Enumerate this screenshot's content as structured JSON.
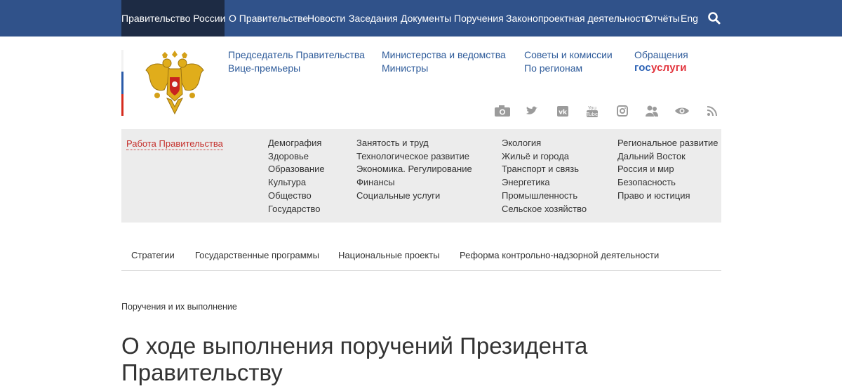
{
  "topbar": {
    "brand": "Правительство России",
    "nav": [
      "О Правительстве",
      "Новости",
      "Заседания",
      "Документы",
      "Поручения",
      "Законопроектная деятельность",
      "Отчёты",
      "Eng"
    ]
  },
  "header": {
    "col1": [
      "Председатель Правительства",
      "Вице-премьеры"
    ],
    "col2": [
      "Министерства и ведомства",
      "Министры"
    ],
    "col3": [
      "Советы и комиссии",
      "По регионам"
    ],
    "appeals": "Обращения",
    "gosuslugi_a": "гос",
    "gosuslugi_b": "услуги"
  },
  "social_icons": [
    "camera-icon",
    "twitter-icon",
    "vk-icon",
    "youtube-icon",
    "instagram-icon",
    "people-icon",
    "eye-icon",
    "rss-icon"
  ],
  "topics": {
    "heading": "Работа Правительства",
    "col1": [
      "Демография",
      "Здоровье",
      "Образование",
      "Культура",
      "Общество",
      "Государство"
    ],
    "col2": [
      "Занятость и труд",
      "Технологическое развитие",
      "Экономика. Регулирование",
      "Финансы",
      "Социальные услуги"
    ],
    "col3": [
      "Экология",
      "Жильё и города",
      "Транспорт и связь",
      "Энергетика",
      "Промышленность",
      "Сельское хозяйство"
    ],
    "col4": [
      "Региональное развитие",
      "Дальний Восток",
      "Россия и мир",
      "Безопасность",
      "Право и юстиция"
    ]
  },
  "subnav": [
    "Стратегии",
    "Государственные программы",
    "Национальные проекты",
    "Реформа контрольно-надзорной деятельности"
  ],
  "breadcrumb": "Поручения и их выполнение",
  "title_line1": "О ходе выполнения поручений Президента",
  "title_line2": "Правительству",
  "colors": {
    "topbar": "#30528a",
    "brand_bg": "#1d2b44",
    "link": "#2e5b9a",
    "accent_red": "#c5302c",
    "panel": "#ececec"
  }
}
